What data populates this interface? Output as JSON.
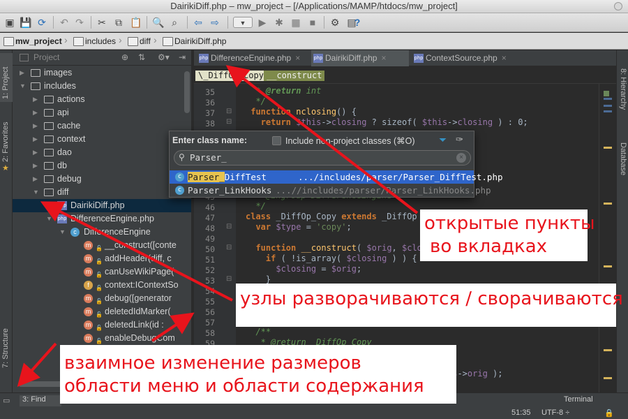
{
  "window": {
    "title": "DairikiDiff.php – mw_project – [/Applications/MAMP/htdocs/mw_project]"
  },
  "breadcrumbs": [
    "mw_project",
    "includes",
    "diff",
    "DairikiDiff.php"
  ],
  "left_strip": {
    "project": "1: Project",
    "favorites": "2: Favorites",
    "structure": "7: Structure"
  },
  "right_strip": {
    "hierarchy": "8: Hierarchy",
    "database": "Database"
  },
  "project_panel": {
    "header": "Project"
  },
  "tree": [
    {
      "label": "images",
      "kind": "folder",
      "depth": 0,
      "expanded": false
    },
    {
      "label": "includes",
      "kind": "folder",
      "depth": 0,
      "expanded": true
    },
    {
      "label": "actions",
      "kind": "folder",
      "depth": 1,
      "expanded": false
    },
    {
      "label": "api",
      "kind": "folder",
      "depth": 1,
      "expanded": false
    },
    {
      "label": "cache",
      "kind": "folder",
      "depth": 1,
      "expanded": false
    },
    {
      "label": "context",
      "kind": "folder",
      "depth": 1,
      "expanded": false
    },
    {
      "label": "dao",
      "kind": "folder",
      "depth": 1,
      "expanded": false
    },
    {
      "label": "db",
      "kind": "folder",
      "depth": 1,
      "expanded": false
    },
    {
      "label": "debug",
      "kind": "folder",
      "depth": 1,
      "expanded": false
    },
    {
      "label": "diff",
      "kind": "folder",
      "depth": 1,
      "expanded": true
    },
    {
      "label": "DairikiDiff.php",
      "kind": "php",
      "depth": 2,
      "selected": true
    },
    {
      "label": "DifferenceEngine.php",
      "kind": "php",
      "depth": 2,
      "expanded": true
    },
    {
      "label": "DifferenceEngine",
      "kind": "class",
      "depth": 3,
      "expanded": true
    },
    {
      "label": "__construct([conte",
      "kind": "method",
      "depth": 4
    },
    {
      "label": "addHeader(diff, c",
      "kind": "method",
      "depth": 4
    },
    {
      "label": "canUseWikiPage(",
      "kind": "method",
      "depth": 4
    },
    {
      "label": "context:IContextSo",
      "kind": "field",
      "depth": 4
    },
    {
      "label": "debug([generator",
      "kind": "method",
      "depth": 4
    },
    {
      "label": "deletedIdMarker(",
      "kind": "method",
      "depth": 4
    },
    {
      "label": "deletedLink(id :",
      "kind": "method",
      "depth": 4
    },
    {
      "label": "enableDebugCom",
      "kind": "method",
      "depth": 4
    }
  ],
  "editor_tabs": [
    {
      "label": "DifferenceEngine.php",
      "active": false
    },
    {
      "label": "DairikiDiff.php",
      "active": true
    },
    {
      "label": "ContextSource.php",
      "active": false
    }
  ],
  "editor_breadcrumb": [
    "\\_DiffOp_Copy",
    "__construct"
  ],
  "gutter_lines": [
    "35",
    "36",
    "37",
    "38",
    "39",
    "40",
    "41",
    "42",
    "43",
    "44",
    "45",
    "46",
    "47",
    "48",
    "49",
    "50",
    "51",
    "52",
    "53",
    "54",
    "55",
    "56",
    "57",
    "58",
    "59",
    "60"
  ],
  "code_lines": [
    {
      "line": 35,
      "text": "* @return int"
    },
    {
      "line": 36,
      "text": "*/"
    },
    {
      "line": 37,
      "text": "function nclosing() {"
    },
    {
      "line": 38,
      "text": "return $this->closing ? sizeof( $this->closing ) : 0;"
    },
    {
      "line": 46,
      "text": "* @ingroup DifferenceEngine"
    },
    {
      "line": 47,
      "text": "*/"
    },
    {
      "line": 48,
      "text": "class _DiffOp_Copy extends _DiffOp {"
    },
    {
      "line": 49,
      "text": "var $type = 'copy';"
    },
    {
      "line": 50,
      "text": "function __construct( $orig, $closing = false ) {"
    },
    {
      "line": 51,
      "text": "if ( !is_array( $closing ) ) {"
    },
    {
      "line": 52,
      "text": "$closing = $orig;"
    },
    {
      "line": 53,
      "text": "}"
    },
    {
      "line": 57,
      "text": "/**"
    },
    {
      "line": 58,
      "text": "* @return _DiffOp_Copy"
    },
    {
      "line": 59,
      "text": "*/"
    },
    {
      "line": 60,
      "text": ", $this->orig );"
    }
  ],
  "popup": {
    "title": "Enter class name:",
    "checkbox_label": "Include non-project classes (⌘O)",
    "query": "Parser_",
    "results": [
      {
        "name": "Parser_DiffTest",
        "match": "Parser_",
        "rest": "DiffTest",
        "path": ".../includes/parser/Parser_DiffTest.php",
        "selected": true
      },
      {
        "name": "Parser_LinkHooks",
        "match": "Parser_",
        "rest": "LinkHooks",
        "path": "...//includes/parser/Parser_LinkHooks.php",
        "selected": false
      }
    ]
  },
  "status": {
    "find": "3: Find",
    "terminal": "Terminal",
    "position": "51:35",
    "encoding": "UTF-8 ÷"
  },
  "annotations": {
    "tabs_note_1": "открытые  пункты",
    "tabs_note_2": "во вкладках",
    "nodes_note": "узлы разворачиваются / сворачиваются",
    "resize_note_1": "взаимное   изменение размеров",
    "resize_note_2": "области меню и области содержания"
  },
  "colors": {
    "annotation": "#e8141c",
    "selection": "#0d293e",
    "editor_bg": "#2b2b2b"
  }
}
